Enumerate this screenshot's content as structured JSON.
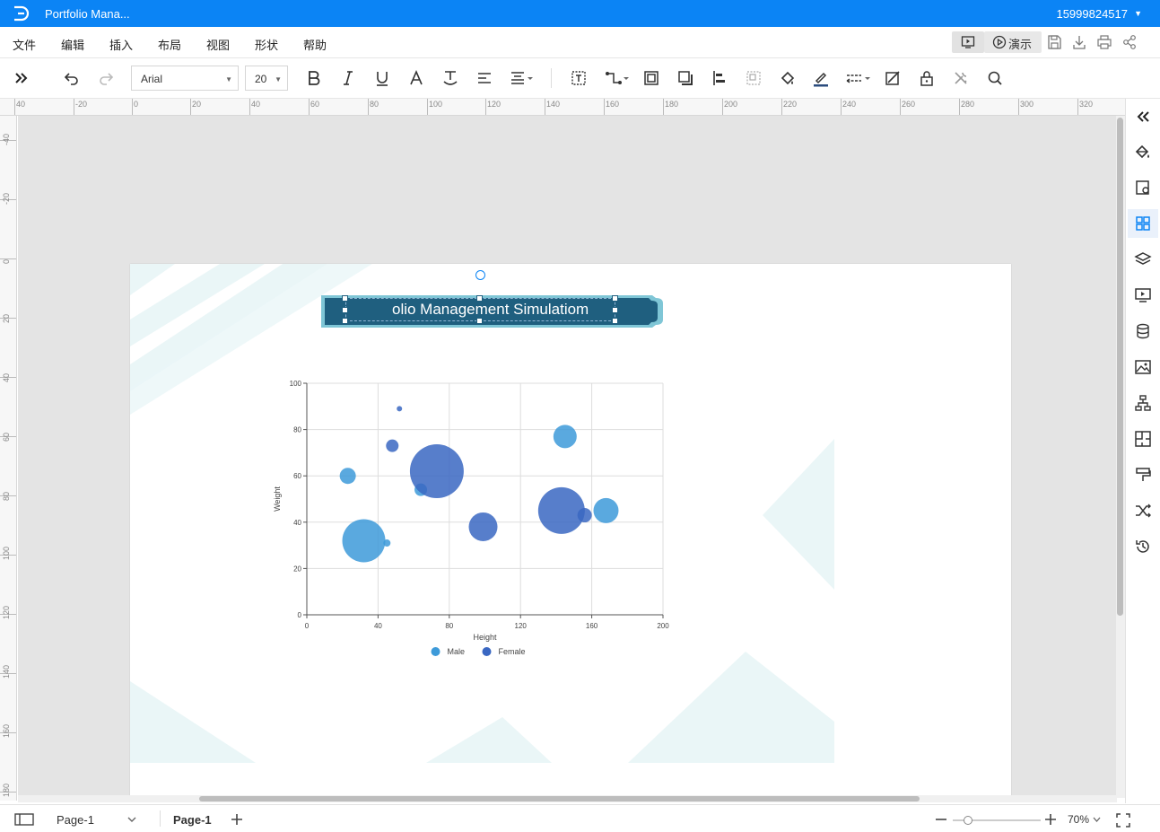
{
  "app": {
    "title": "Portfolio Mana...",
    "user": "15999824517"
  },
  "menu": [
    "文件",
    "编辑",
    "插入",
    "布局",
    "视图",
    "形状",
    "帮助"
  ],
  "menubar": {
    "present_label": "演示"
  },
  "toolbar": {
    "font_family": "Arial",
    "font_size": "20"
  },
  "ruler": {
    "h_ticks": [
      "40",
      "-20",
      "0",
      "20",
      "40",
      "60",
      "80",
      "100",
      "120",
      "140",
      "160",
      "180",
      "200",
      "220",
      "240",
      "260",
      "280",
      "300",
      "320"
    ],
    "v_ticks": [
      "-40",
      "-20",
      "0",
      "20",
      "40",
      "60",
      "80",
      "100",
      "120",
      "140",
      "160",
      "180"
    ]
  },
  "slide": {
    "title": "olio Management Simulatiom"
  },
  "chart_data": {
    "type": "scatter",
    "title": "",
    "xlabel": "Height",
    "ylabel": "Weight",
    "xlim": [
      0,
      200
    ],
    "ylim": [
      0,
      100
    ],
    "xticks": [
      "0",
      "40",
      "80",
      "120",
      "160",
      "200"
    ],
    "yticks": [
      "0",
      "20",
      "40",
      "60",
      "80",
      "100"
    ],
    "grid": true,
    "legend": "bottom",
    "series": [
      {
        "name": "Male",
        "color": "#3d9ad9",
        "points": [
          {
            "x": 23,
            "y": 60,
            "r": 9
          },
          {
            "x": 32,
            "y": 32,
            "r": 24
          },
          {
            "x": 45,
            "y": 31,
            "r": 4
          },
          {
            "x": 64,
            "y": 54,
            "r": 7
          },
          {
            "x": 145,
            "y": 77,
            "r": 13
          },
          {
            "x": 168,
            "y": 45,
            "r": 14
          }
        ]
      },
      {
        "name": "Female",
        "color": "#3a67c2",
        "points": [
          {
            "x": 52,
            "y": 89,
            "r": 3
          },
          {
            "x": 48,
            "y": 73,
            "r": 7
          },
          {
            "x": 73,
            "y": 62,
            "r": 30
          },
          {
            "x": 99,
            "y": 38,
            "r": 16
          },
          {
            "x": 143,
            "y": 45,
            "r": 26
          },
          {
            "x": 156,
            "y": 43,
            "r": 8
          }
        ]
      }
    ]
  },
  "bottom": {
    "page_selector": "Page-1",
    "page_tab": "Page-1",
    "zoom": "70%"
  }
}
